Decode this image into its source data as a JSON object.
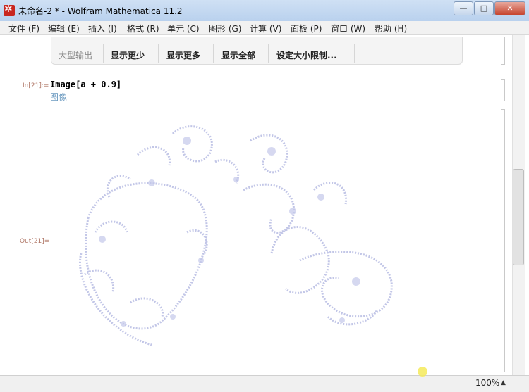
{
  "window": {
    "title": "未命名-2 * - Wolfram Mathematica 11.2",
    "min_glyph": "—",
    "max_glyph": "□",
    "close_glyph": "✕"
  },
  "menu": [
    "文件 (F)",
    "编辑 (E)",
    "插入 (I)",
    "格式 (R)",
    "单元 (C)",
    "图形 (G)",
    "计算 (V)",
    "面板 (P)",
    "窗口 (W)",
    "帮助 (H)"
  ],
  "output_toolbar": {
    "title": "大型输出",
    "buttons": [
      "显示更少",
      "显示更多",
      "显示全部",
      "设定大小限制..."
    ]
  },
  "cell_in": {
    "label": "In[21]:=",
    "code": "Image[a + 0.9]",
    "hint": "图像"
  },
  "cell_out": {
    "label": "Out[21]="
  },
  "status": {
    "zoom": "100%",
    "zoom_arrow": "▲"
  },
  "colors": {
    "fractal": "#b8bde3",
    "label": "#b07767",
    "hint": "#6b9ac0"
  }
}
